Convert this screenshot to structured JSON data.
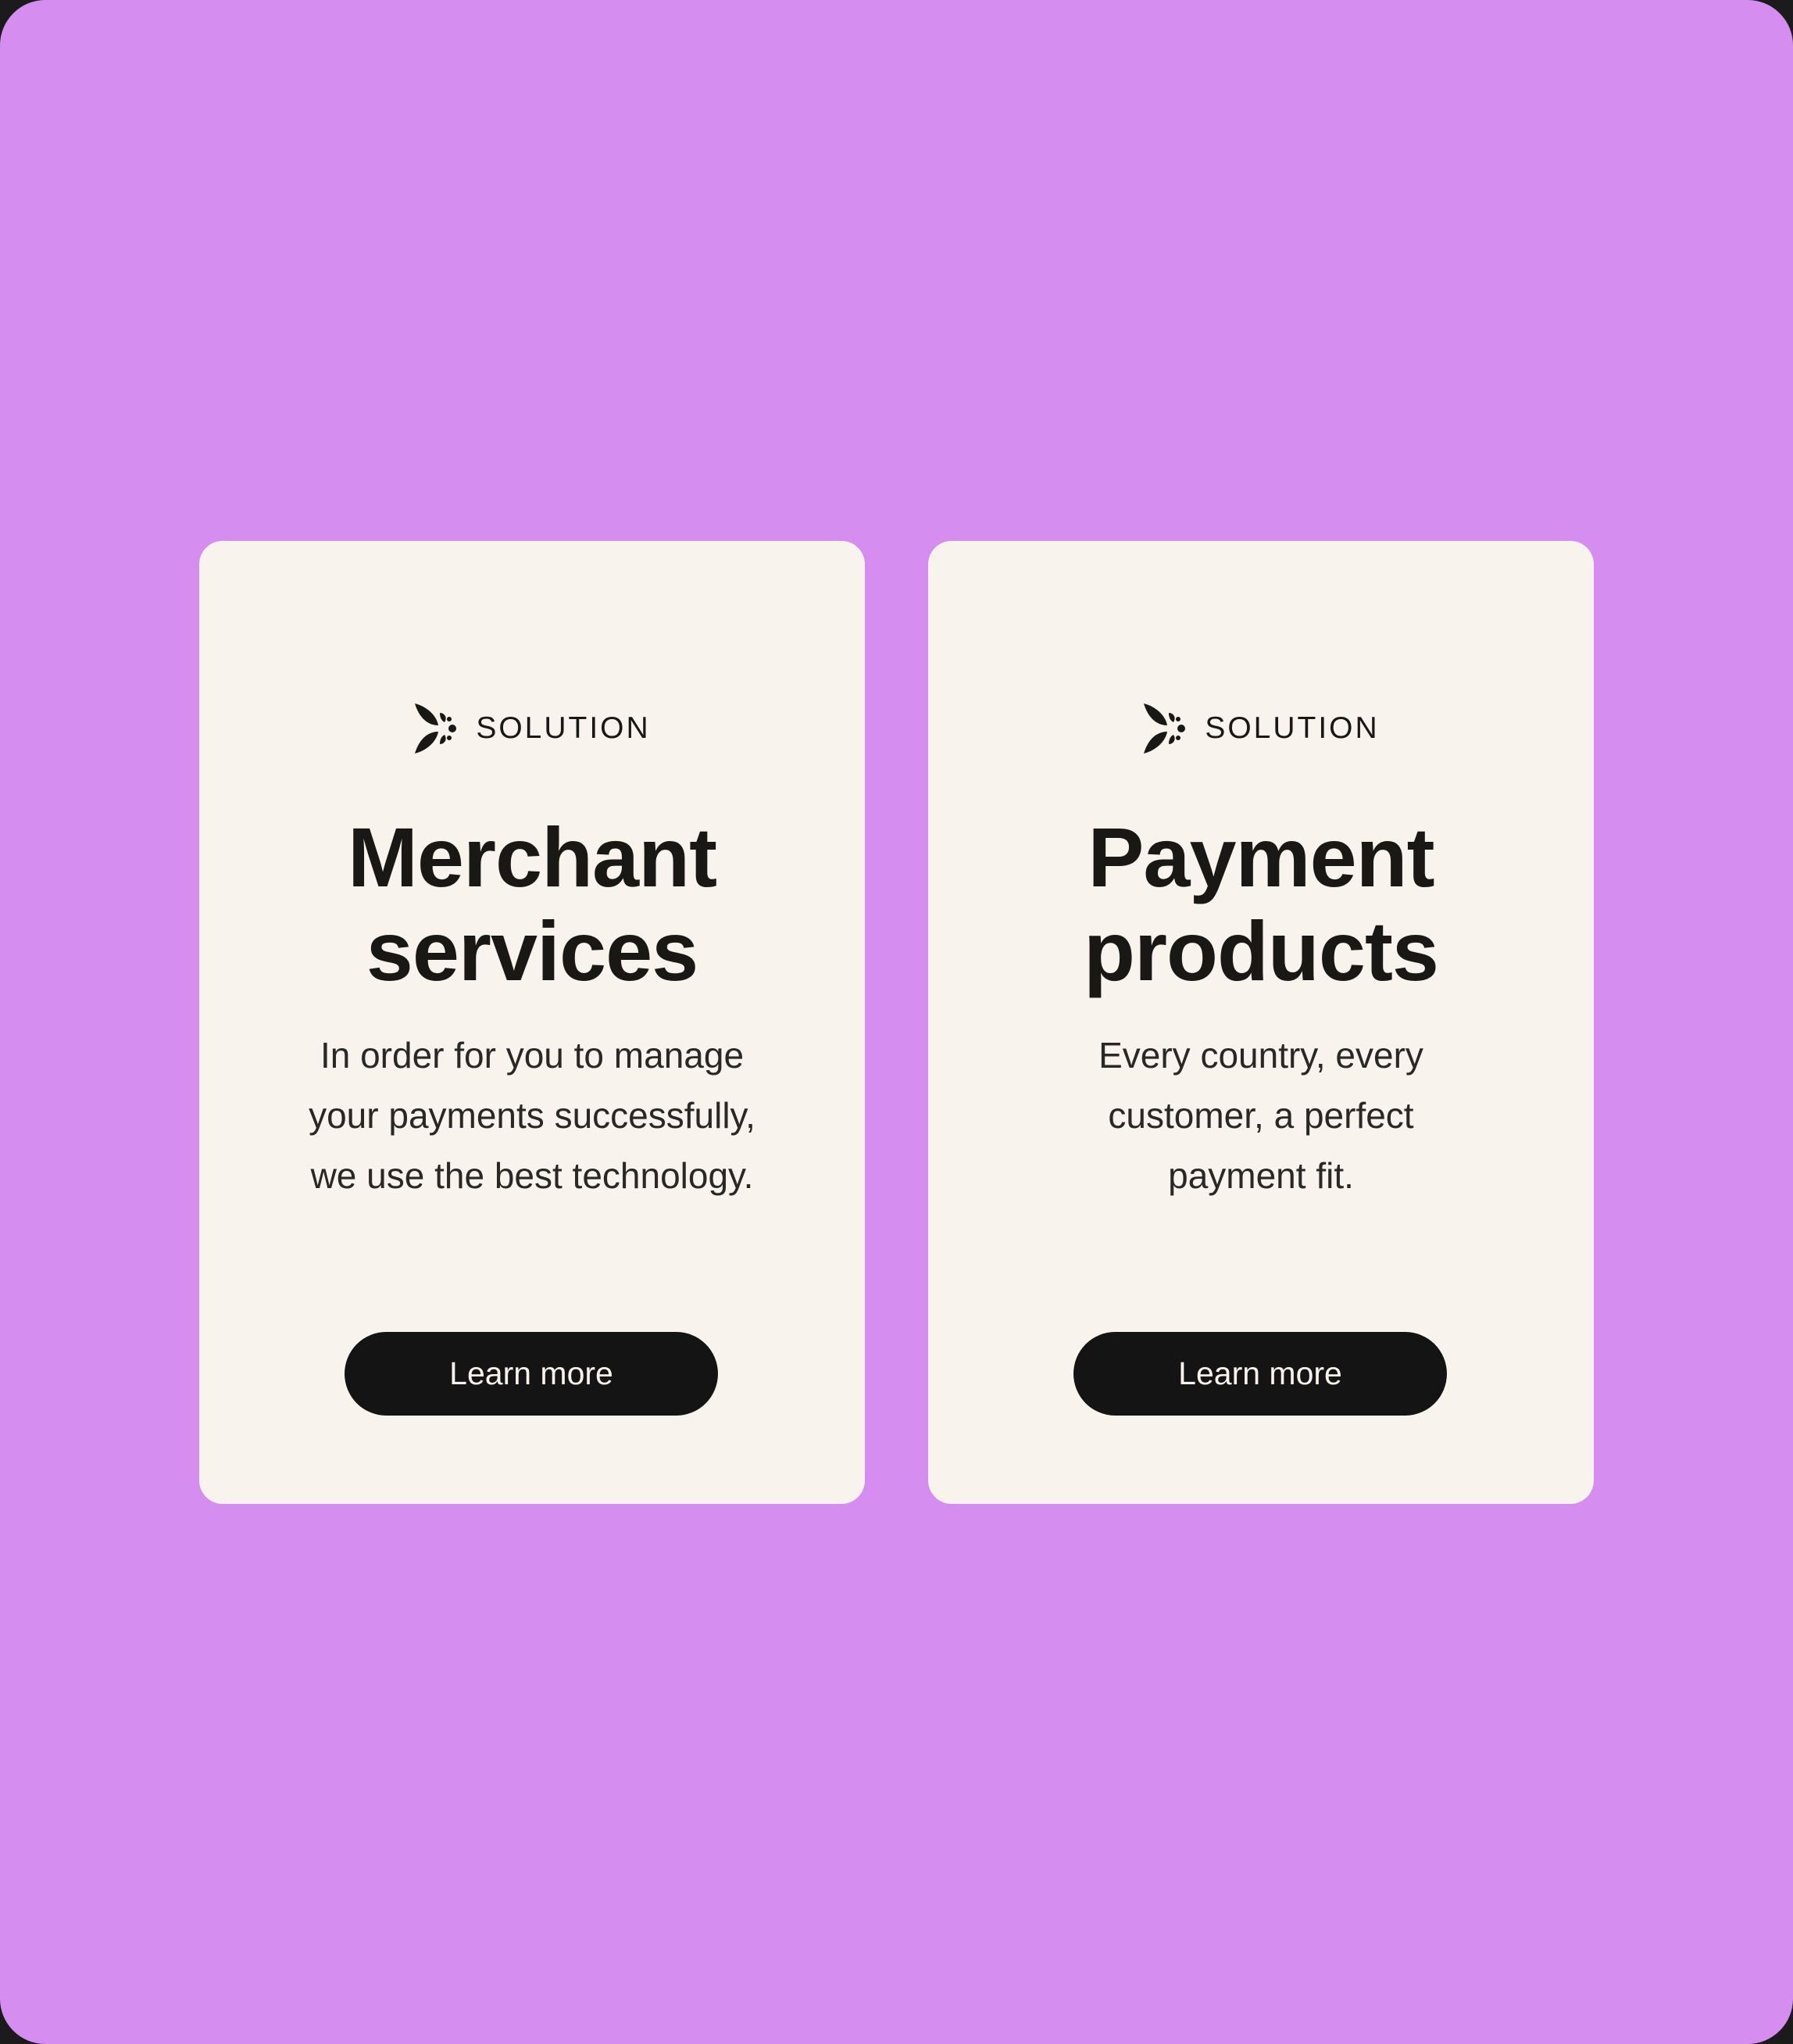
{
  "cards": [
    {
      "eyebrow_icon": "solution-logo-icon",
      "eyebrow": "SOLUTION",
      "title_lines": [
        "Merchant",
        "services"
      ],
      "description_lines": [
        "In order for you to manage",
        "your payments successfully,",
        "we use the best technology."
      ],
      "button_label": "Learn more"
    },
    {
      "eyebrow_icon": "solution-logo-icon",
      "eyebrow": "SOLUTION",
      "title_lines": [
        "Payment",
        "products"
      ],
      "description_lines": [
        "Every country, every",
        "customer, a perfect",
        "payment fit."
      ],
      "button_label": "Learn more"
    }
  ],
  "colors": {
    "background": "#d68df0",
    "card": "#f8f4ed",
    "text": "#1a1815",
    "button": "#141414",
    "button_text": "#f8f4ed"
  }
}
